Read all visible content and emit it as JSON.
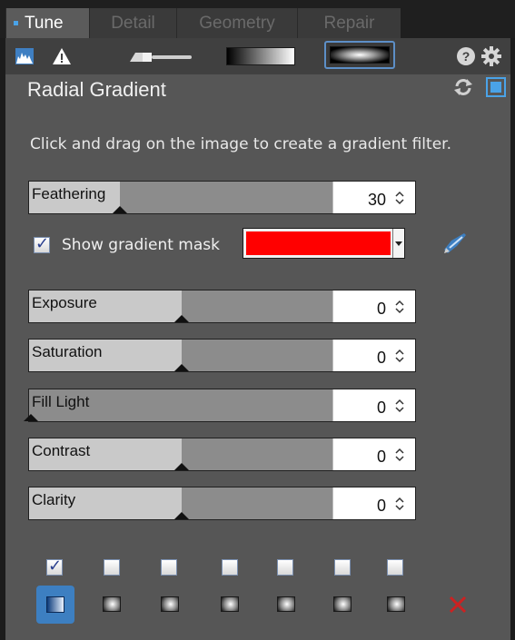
{
  "tabs": [
    {
      "label": "Tune",
      "active": true
    },
    {
      "label": "Detail",
      "active": false
    },
    {
      "label": "Geometry",
      "active": false
    },
    {
      "label": "Repair",
      "active": false
    }
  ],
  "toolbar": {
    "icons": [
      "histogram-icon",
      "warning-icon",
      "brush-tool-icon",
      "linear-gradient-tool-icon",
      "radial-gradient-tool-icon",
      "help-icon",
      "gear-icon"
    ]
  },
  "panel": {
    "title": "Radial Gradient",
    "description": "Click and drag on the image to create a gradient filter."
  },
  "sliders": [
    {
      "label": "Feathering",
      "value": "30",
      "fill_pct": 0.3
    },
    {
      "label": "Exposure",
      "value": "0",
      "fill_pct": 0.5
    },
    {
      "label": "Saturation",
      "value": "0",
      "fill_pct": 0.5
    },
    {
      "label": "Fill Light",
      "value": "0",
      "fill_pct": 0.0
    },
    {
      "label": "Contrast",
      "value": "0",
      "fill_pct": 0.5
    },
    {
      "label": "Clarity",
      "value": "0",
      "fill_pct": 0.5
    }
  ],
  "mask": {
    "checkbox_label": "Show gradient mask",
    "checked": true,
    "color": "#ff0000"
  },
  "colors": {
    "accent": "#4aa3e8",
    "panel_bg": "#565656",
    "delete": "#cc2222"
  },
  "filters": {
    "checkboxes": [
      true,
      false,
      false,
      false,
      false,
      false,
      false
    ],
    "selected_index": 0
  }
}
